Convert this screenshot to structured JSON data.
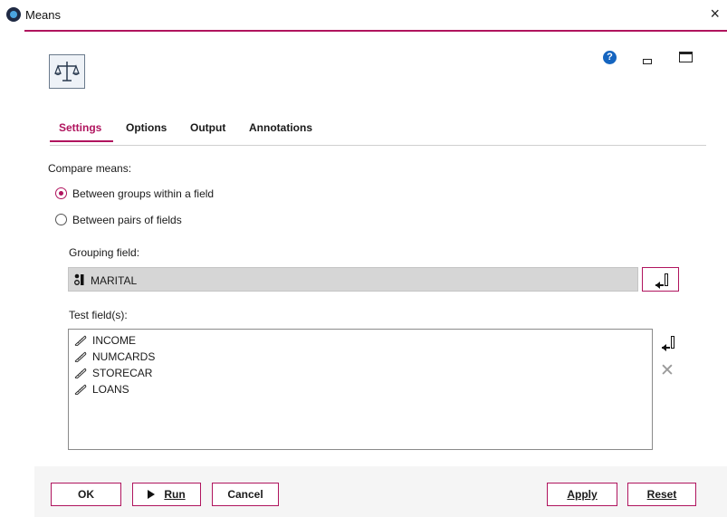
{
  "window": {
    "title": "Means",
    "close_glyph": "×"
  },
  "icons": {
    "app": "spss-modeler-icon",
    "node": "balance-scale-icon",
    "help": "help-icon",
    "help_glyph": "?",
    "minimize": "minimize-icon",
    "maximize": "maximize-icon"
  },
  "tabs": [
    {
      "label": "Settings",
      "active": true
    },
    {
      "label": "Options",
      "active": false
    },
    {
      "label": "Output",
      "active": false
    },
    {
      "label": "Annotations",
      "active": false
    }
  ],
  "settings": {
    "compare_label": "Compare means:",
    "options": [
      {
        "label": "Between groups within a field",
        "checked": true
      },
      {
        "label": "Between pairs of fields",
        "checked": false
      }
    ],
    "grouping_field_label": "Grouping field:",
    "grouping_field_value": "MARITAL",
    "test_fields_label": "Test field(s):",
    "test_fields": [
      "INCOME",
      "NUMCARDS",
      "STORECAR",
      "LOANS"
    ]
  },
  "buttons": {
    "ok": "OK",
    "run": "Run",
    "cancel": "Cancel",
    "apply": "Apply",
    "reset": "Reset"
  },
  "colors": {
    "accent": "#b0145e",
    "help": "#1565c0"
  }
}
